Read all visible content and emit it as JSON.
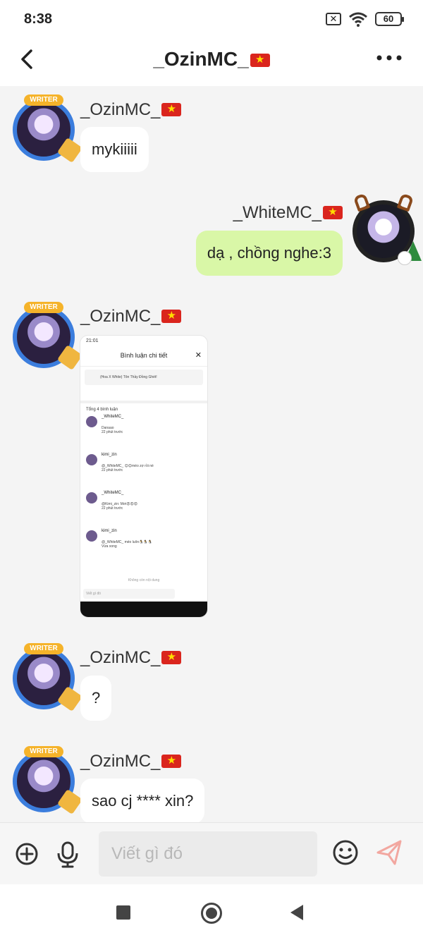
{
  "status_bar": {
    "time": "8:38",
    "battery": "60",
    "sim_mark": "✕"
  },
  "header": {
    "title": "_OzinMC_"
  },
  "avatar_badge": "WRITER",
  "messages": [
    {
      "sender": "_OzinMC_",
      "text": "mykiiiii"
    },
    {
      "sender": "_WhiteMC_",
      "text": "dạ , chồng nghe:3"
    },
    {
      "sender": "_OzinMC_",
      "attachment": "screenshot"
    },
    {
      "sender": "_OzinMC_",
      "text": "?"
    },
    {
      "sender": "_OzinMC_",
      "text": "sao cj **** xin?"
    }
  ],
  "shared_screenshot": {
    "time": "21:01",
    "title": "Bình luận chi tiết",
    "close": "✕",
    "post_title": "(Hoa X White) Tôn Thầy Đồng Ghét!",
    "total_comments": "Tổng 4 bình luận",
    "comments": [
      {
        "user": "_WhiteMC_",
        "text": "Danaao",
        "time": "22 phút trước"
      },
      {
        "user": "kimi_zin",
        "text": "@_WhiteMC_ 😊😊méo zợ rồi nè",
        "time": "22 phút trước"
      },
      {
        "user": "_WhiteMC_",
        "text": "@Kimi_zin: Mơi😡😡😡",
        "time": "22 phút trước"
      },
      {
        "user": "kimi_zin",
        "text": "@_WhiteMC_ méo luôn🐧🐧🐧",
        "time": "Vừa xong"
      }
    ],
    "no_more": "Không còn nội dung",
    "input_placeholder": "Viết gì đó"
  },
  "composer": {
    "placeholder": "Viết gì đó"
  },
  "colors": {
    "my_bubble": "#d9f7a7",
    "other_bubble": "#ffffff",
    "background": "#f4f4f4",
    "send_icon": "#f2a7a0",
    "avatar_ring": "#3b7ddd"
  },
  "icons": {
    "back": "back-arrow-icon",
    "more": "more-dots-icon",
    "add": "plus-circle-icon",
    "voice": "microphone-icon",
    "emoji": "emoji-icon",
    "send": "send-icon"
  }
}
